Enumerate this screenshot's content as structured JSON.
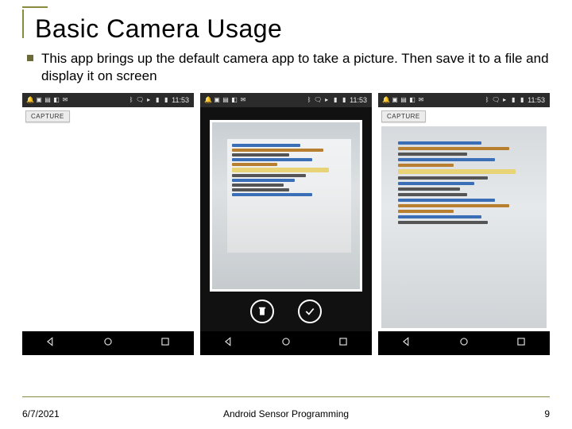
{
  "title": "Basic Camera Usage",
  "bullet_text": "This app brings up the default camera app to take a picture. Then save it to a file and display it on screen",
  "statusbar": {
    "time": "11:53"
  },
  "capture_button": "CAPTURE",
  "footer": {
    "date": "6/7/2021",
    "course": "Android Sensor Programming",
    "page": "9"
  }
}
